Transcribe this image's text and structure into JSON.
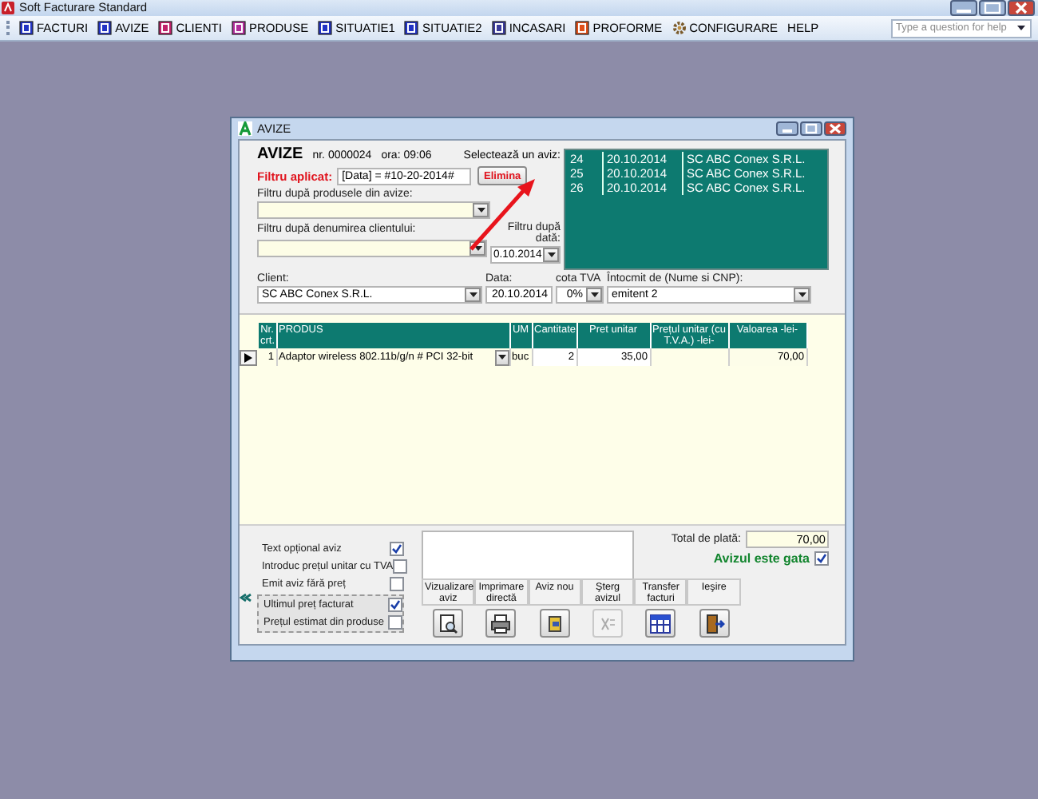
{
  "app": {
    "title": "Soft Facturare Standard",
    "help": {
      "placeholder": "Type a question for help"
    }
  },
  "menu": [
    {
      "label": "FACTURI",
      "kind": "box",
      "color": "#2233c4"
    },
    {
      "label": "AVIZE",
      "kind": "box",
      "color": "#2233c4"
    },
    {
      "label": "CLIENTI",
      "kind": "box",
      "color": "#c0206a"
    },
    {
      "label": "PRODUSE",
      "kind": "box",
      "color": "#b02c9a"
    },
    {
      "label": "SITUATIE1",
      "kind": "box",
      "color": "#2233c4"
    },
    {
      "label": "SITUATIE2",
      "kind": "box",
      "color": "#2233c4"
    },
    {
      "label": "INCASARI",
      "kind": "box",
      "color": "#3a3a9a"
    },
    {
      "label": "PROFORME",
      "kind": "box",
      "color": "#e0501a"
    },
    {
      "label": "CONFIGURARE",
      "kind": "gear"
    },
    {
      "label": "HELP",
      "kind": "none"
    }
  ],
  "dialog": {
    "title": "AVIZE",
    "heading": "AVIZE",
    "number_label": "nr.",
    "number": "0000024",
    "time_label": "ora:",
    "time": "09:06",
    "filter": {
      "label": "Filtru aplicat:",
      "value": "[Data] = #10-20-2014#",
      "button": "Elimina"
    },
    "product_filter": {
      "label": "Filtru după produsele din avize:"
    },
    "client_filter": {
      "label": "Filtru după denumirea clientului:"
    },
    "date_filter": {
      "label": "Filtru după dată:",
      "value": "0.10.2014"
    },
    "picker": {
      "label": "Selectează un aviz:",
      "rows": [
        {
          "number": "24",
          "date": "20.10.2014",
          "client": "SC ABC Conex S.R.L."
        },
        {
          "number": "25",
          "date": "20.10.2014",
          "client": "SC ABC Conex S.R.L."
        },
        {
          "number": "26",
          "date": "20.10.2014",
          "client": "SC ABC Conex S.R.L."
        }
      ]
    },
    "fields": [
      {
        "label": "Client:",
        "value": "SC ABC Conex S.R.L.",
        "kind": "combo"
      },
      {
        "label": "Data:",
        "value": "20.10.2014",
        "kind": "text"
      },
      {
        "label": "cota TVA",
        "value": "0%",
        "kind": "combo"
      },
      {
        "label": "Întocmit de (Nume si CNP):",
        "value": "emitent 2",
        "kind": "combo"
      }
    ],
    "grid": {
      "columns": [
        "Nr. crt.",
        "PRODUS",
        "UM",
        "Cantitate",
        "Pret unitar",
        "Prețul unitar (cu T.V.A.) -lei-",
        "Valoarea -lei-"
      ],
      "rows": [
        {
          "selected": true,
          "cells": [
            "1",
            "Adaptor wireless 802.11b/g/n # PCI 32-bit",
            "buc",
            "2",
            "35,00",
            null,
            "70,00"
          ]
        }
      ]
    },
    "options": [
      {
        "label": "Text opțional aviz",
        "checked": true
      },
      {
        "label": "Introduc prețul unitar cu TVA",
        "checked": false
      },
      {
        "label": "Emit aviz fără preț",
        "checked": false
      }
    ],
    "price_source": [
      {
        "label": "Ultimul preț facturat",
        "checked": true
      },
      {
        "label": "Prețul estimat din produse",
        "checked": false
      }
    ],
    "total": {
      "label": "Total de plată:",
      "value": "70,00"
    },
    "ready": {
      "label": "Avizul este gata",
      "checked": true
    },
    "actions": [
      {
        "label": "Vizualizare aviz",
        "kind": "preview",
        "disabled": false
      },
      {
        "label": "Imprimare directă",
        "kind": "print",
        "disabled": false
      },
      {
        "label": "Aviz nou",
        "kind": "new",
        "disabled": false
      },
      {
        "label": "Şterg avizul",
        "kind": "delete",
        "disabled": true
      },
      {
        "label": "Transfer facturi",
        "kind": "transfer",
        "disabled": false
      },
      {
        "label": "Ieşire",
        "kind": "exit",
        "disabled": false
      }
    ]
  }
}
